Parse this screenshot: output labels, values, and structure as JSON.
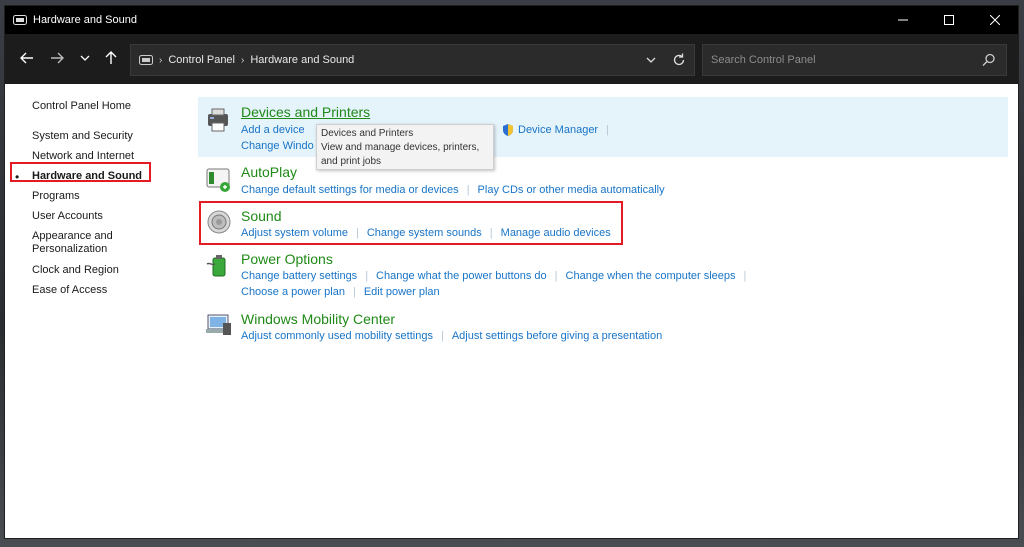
{
  "window": {
    "title": "Hardware and Sound"
  },
  "nav": {
    "breadcrumb": [
      "Control Panel",
      "Hardware and Sound"
    ],
    "search_placeholder": "Search Control Panel"
  },
  "sidebar": {
    "home": "Control Panel Home",
    "items": [
      {
        "label": "System and Security"
      },
      {
        "label": "Network and Internet"
      },
      {
        "label": "Hardware and Sound",
        "active": true
      },
      {
        "label": "Programs"
      },
      {
        "label": "User Accounts"
      },
      {
        "label": "Appearance and Personalization"
      },
      {
        "label": "Clock and Region"
      },
      {
        "label": "Ease of Access"
      }
    ]
  },
  "categories": {
    "devices": {
      "title": "Devices and Printers",
      "link1": "Add a device",
      "link2_partial": "Change Windo",
      "device_manager": "Device Manager",
      "tooltip_title": "Devices and Printers",
      "tooltip_body": "View and manage devices, printers, and print jobs"
    },
    "autoplay": {
      "title": "AutoPlay",
      "links": [
        "Change default settings for media or devices",
        "Play CDs or other media automatically"
      ]
    },
    "sound": {
      "title": "Sound",
      "links": [
        "Adjust system volume",
        "Change system sounds",
        "Manage audio devices"
      ]
    },
    "power": {
      "title": "Power Options",
      "links_row1": [
        "Change battery settings",
        "Change what the power buttons do",
        "Change when the computer sleeps"
      ],
      "links_row2": [
        "Choose a power plan",
        "Edit power plan"
      ]
    },
    "mobility": {
      "title": "Windows Mobility Center",
      "links": [
        "Adjust commonly used mobility settings",
        "Adjust settings before giving a presentation"
      ]
    }
  },
  "colors": {
    "accent_green": "#1f8a17",
    "link_blue": "#1874c7",
    "highlight_red": "#e51b24"
  }
}
